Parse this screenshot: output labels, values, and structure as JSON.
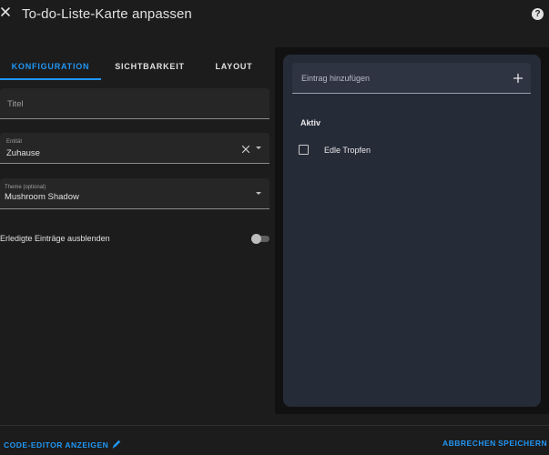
{
  "dialog": {
    "title": "To-do-Liste-Karte anpassen",
    "help_glyph": "?"
  },
  "tabs": [
    {
      "label": "KONFIGURATION",
      "active": true
    },
    {
      "label": "SICHTBARKEIT",
      "active": false
    },
    {
      "label": "LAYOUT",
      "active": false
    }
  ],
  "form": {
    "title_field": {
      "placeholder": "Titel",
      "value": ""
    },
    "entity_field": {
      "label": "Entität",
      "value": "Zuhause"
    },
    "theme_field": {
      "label": "Theme (optional)",
      "value": "Mushroom Shadow"
    },
    "hide_completed": {
      "label": "Erledigte Einträge ausblenden",
      "checked": false
    }
  },
  "preview": {
    "add_item_placeholder": "Eintrag hinzufügen",
    "section_title": "Aktiv",
    "items": [
      {
        "label": "Edle Tropfen",
        "checked": false
      }
    ]
  },
  "footer": {
    "code_editor_label": "CODE-EDITOR ANZEIGEN",
    "cancel_label": "ABBRECHEN",
    "save_label": "SPEICHERN"
  },
  "colors": {
    "accent": "#2196f3",
    "background": "#1c1c1c",
    "card": "#262b38"
  },
  "icons": {
    "close": "close-icon",
    "help": "help-icon",
    "clear": "close-icon",
    "dropdown": "menu-down-icon",
    "plus": "plus-icon",
    "pencil": "pencil-icon"
  }
}
